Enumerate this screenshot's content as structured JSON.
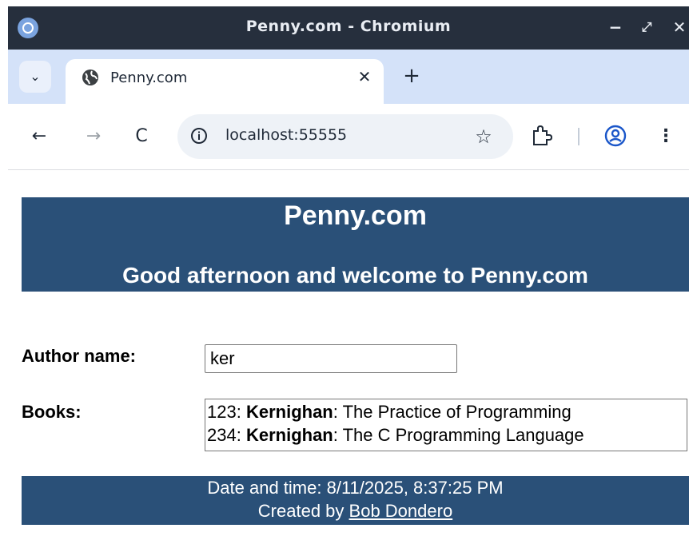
{
  "window": {
    "title": "Penny.com - Chromium",
    "minimize_label": "−",
    "maximize_label": "⤢",
    "close_label": "✕"
  },
  "tabs": {
    "dropdown_label": "⌄",
    "items": [
      {
        "title": "Penny.com",
        "close_label": "✕"
      }
    ],
    "new_tab_label": "+"
  },
  "toolbar": {
    "back_label": "←",
    "forward_label": "→",
    "reload_label": "C",
    "url": "localhost:55555",
    "bookmark_label": "☆",
    "menu_label": "⋮"
  },
  "page": {
    "site_title": "Penny.com",
    "greeting": "Good afternoon and welcome to Penny.com",
    "author_label": "Author name:",
    "author_value": "ker",
    "books_label": "Books:",
    "books": [
      {
        "isbn": "123",
        "sep1": ": ",
        "author": "Kernighan",
        "sep2": ": ",
        "title": "The Practice of Programming"
      },
      {
        "isbn": "234",
        "sep1": ": ",
        "author": "Kernighan",
        "sep2": ": ",
        "title": "The C Programming Language"
      }
    ],
    "footer": {
      "datetime_text": "Date and time: 8/11/2025, 8:37:25 PM",
      "created_by_prefix": "Created by ",
      "creator_link": "Bob Dondero"
    }
  },
  "colors": {
    "titlebar_bg": "#262f3d",
    "tabstrip_bg": "#d4e2f9",
    "omnibox_bg": "#eef2f7",
    "brand_band": "#2a5078"
  }
}
